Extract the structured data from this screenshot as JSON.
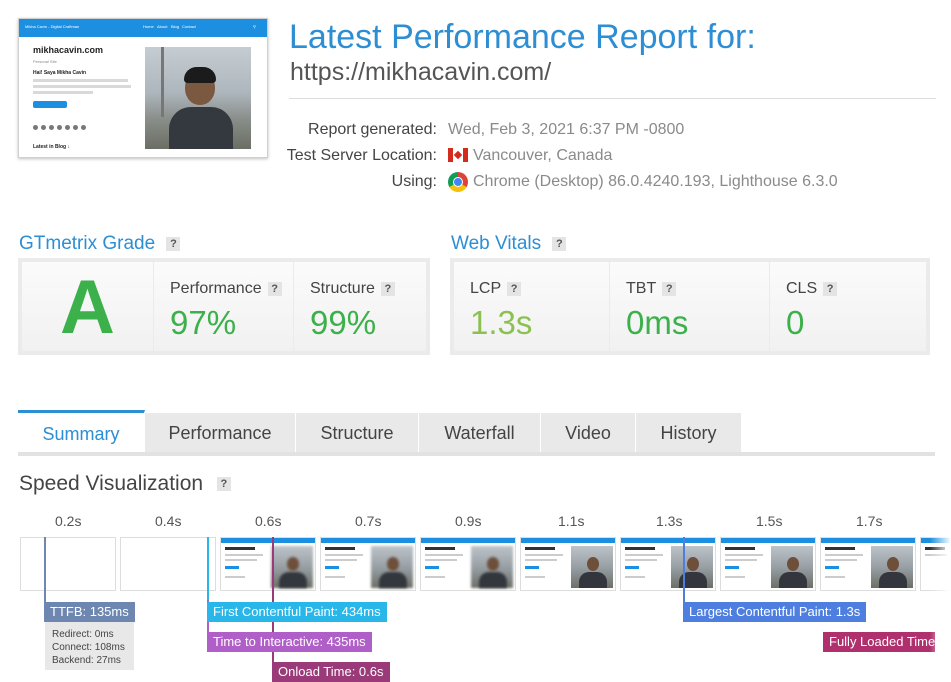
{
  "report": {
    "title": "Latest Performance Report for:",
    "url": "https://mikhacavin.com/",
    "meta": [
      {
        "label": "Report generated:",
        "value": "Wed, Feb 3, 2021 6:37 PM -0800"
      },
      {
        "label": "Test Server Location:",
        "value": "Vancouver, Canada",
        "icon": "canada-flag-icon"
      },
      {
        "label": "Using:",
        "value": "Chrome (Desktop) 86.0.4240.193, Lighthouse 6.3.0",
        "icon": "chrome-icon"
      }
    ]
  },
  "thumbnail": {
    "nav_brand": "Mikha Cavin - Digital Craftman",
    "nav_links": [
      "Home",
      "About",
      "Blog",
      "Contact"
    ],
    "domain": "mikhacavin.com",
    "subtitle": "Personal Site",
    "heading": "Hai! Saya Mikha Cavin",
    "button": "Contact me",
    "blog": "Latest in Blog ↓"
  },
  "gtmetrix": {
    "heading": "GTmetrix Grade",
    "help": "?",
    "grade": "A",
    "performance_label": "Performance",
    "performance_value": "97%",
    "structure_label": "Structure",
    "structure_value": "99%"
  },
  "web_vitals": {
    "heading": "Web Vitals",
    "lcp_label": "LCP",
    "lcp_value": "1.3s",
    "tbt_label": "TBT",
    "tbt_value": "0ms",
    "cls_label": "CLS",
    "cls_value": "0"
  },
  "tabs": [
    "Summary",
    "Performance",
    "Structure",
    "Waterfall",
    "Video",
    "History"
  ],
  "active_tab": "Summary",
  "speed_viz": {
    "heading": "Speed Visualization",
    "time_labels": [
      "0.2s",
      "0.4s",
      "0.6s",
      "0.7s",
      "0.9s",
      "1.1s",
      "1.3s",
      "1.5s",
      "1.7s"
    ],
    "markers": {
      "ttfb": "TTFB: 135ms",
      "fcp": "First Contentful Paint: 434ms",
      "tti": "Time to Interactive: 435ms",
      "onload": "Onload Time: 0.6s",
      "lcp": "Largest Contentful Paint: 1.3s",
      "fully_loaded": "Fully Loaded Time"
    },
    "ttfb_detail": {
      "redirect": "Redirect: 0ms",
      "connect": "Connect: 108ms",
      "backend": "Backend: 27ms"
    }
  },
  "colors": {
    "accent": "#2d8ed3",
    "grade_green": "#3cb04a",
    "lcp_green": "#8cc152",
    "ttfb": "#6d87b0",
    "fcp": "#29b6e8",
    "tti": "#b05fc8",
    "onload": "#9a3a78",
    "lcp_marker": "#4e7fe0",
    "fully_loaded": "#b0306e"
  }
}
